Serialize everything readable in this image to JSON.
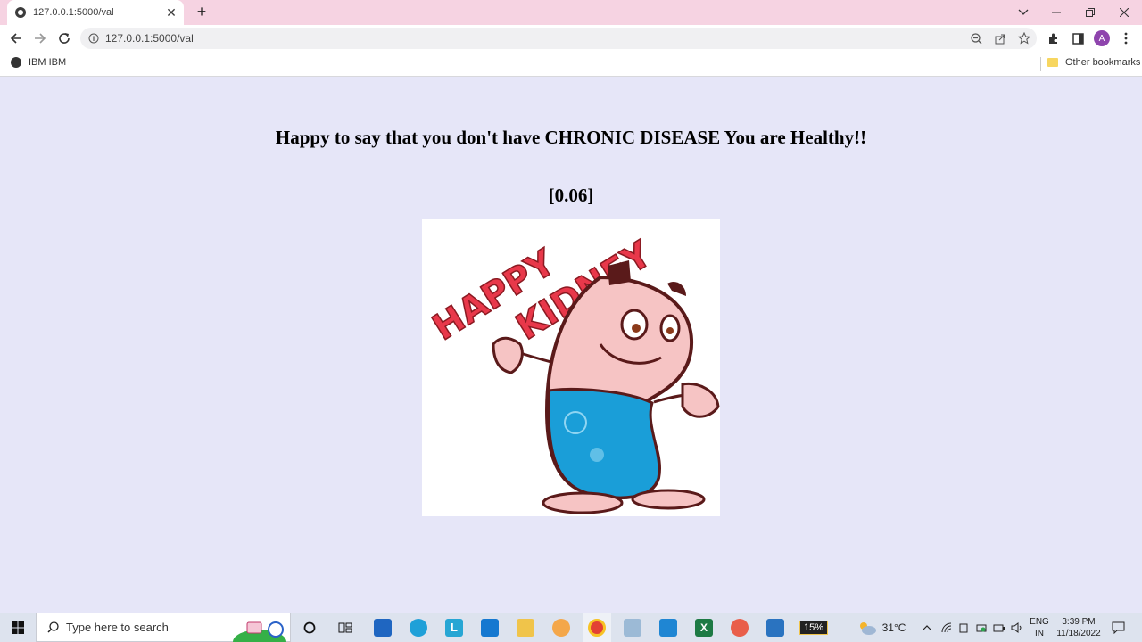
{
  "browser": {
    "tab_title": "127.0.0.1:5000/val",
    "url": "127.0.0.1:5000/val",
    "bookmarks": [
      {
        "label": "IBM IBM",
        "icon": "globe-icon"
      }
    ],
    "other_bookmarks": "Other bookmarks",
    "profile_initial": "A"
  },
  "page": {
    "headline": "Happy to say that you don't have CHRONIC DISEASE You are Healthy!!",
    "score": "[0.06]",
    "image_text": [
      "HAPPY",
      "KIDNEY"
    ]
  },
  "taskbar": {
    "search_placeholder": "Type here to search",
    "battery": "15%",
    "temperature": "31°C",
    "lang_top": "ENG",
    "lang_bottom": "IN",
    "time": "3:39 PM",
    "date": "11/18/2022"
  },
  "colors": {
    "tab_strip": "#f6d3e2",
    "page_bg": "#e6e6f8",
    "taskbar": "#dde3ee"
  }
}
